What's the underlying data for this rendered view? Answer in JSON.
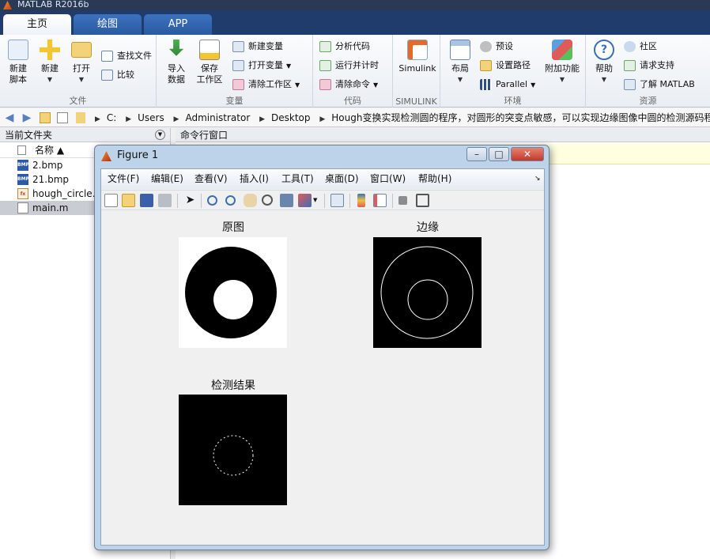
{
  "app": {
    "title": "MATLAB R2016b"
  },
  "tabs": [
    {
      "label": "主页"
    },
    {
      "label": "绘图"
    },
    {
      "label": "APP"
    }
  ],
  "ribbon": {
    "file": {
      "label": "文件",
      "new_script": [
        "新建",
        "脚本"
      ],
      "new": "新建",
      "open": "打开",
      "find_files": "查找文件",
      "compare": "比较"
    },
    "variable": {
      "label": "变量",
      "import": [
        "导入",
        "数据"
      ],
      "save": [
        "保存",
        "工作区"
      ],
      "new_var": "新建变量",
      "open_var": "打开变量",
      "clear_ws": "清除工作区"
    },
    "code": {
      "label": "代码",
      "analyze": "分析代码",
      "run_time": "运行并计时",
      "clear_cmd": "清除命令"
    },
    "simulink": {
      "label": "SIMULINK",
      "btn": "Simulink"
    },
    "env": {
      "label": "环境",
      "layout": "布局",
      "prefs": "预设",
      "set_path": "设置路径",
      "parallel": "Parallel",
      "addons": "附加功能"
    },
    "resources": {
      "label": "资源",
      "help": "帮助",
      "community": "社区",
      "support": "请求支持",
      "learn": "了解 MATLAB"
    }
  },
  "address": {
    "crumbs": [
      "C:",
      "Users",
      "Administrator",
      "Desktop",
      "Hough变换实现检测圆的程序，对圆形的突变点敏感，可以实现边缘图像中圆的检测源码程序"
    ]
  },
  "file_panel": {
    "title": "当前文件夹",
    "column": "名称 ▲",
    "files": [
      "2.bmp",
      "21.bmp",
      "hough_circle.m",
      "main.m"
    ]
  },
  "command_panel": {
    "title": "命令行窗口"
  },
  "figure": {
    "title": "Figure 1",
    "menu": [
      "文件(F)",
      "编辑(E)",
      "查看(V)",
      "插入(I)",
      "工具(T)",
      "桌面(D)",
      "窗口(W)",
      "帮助(H)"
    ],
    "axes_titles": [
      "原图",
      "边缘",
      "检测结果"
    ]
  },
  "colors": {
    "accent": "#1f3c6d",
    "tab_active": "#ffffff",
    "figure_frame": "#bcd3ea"
  }
}
